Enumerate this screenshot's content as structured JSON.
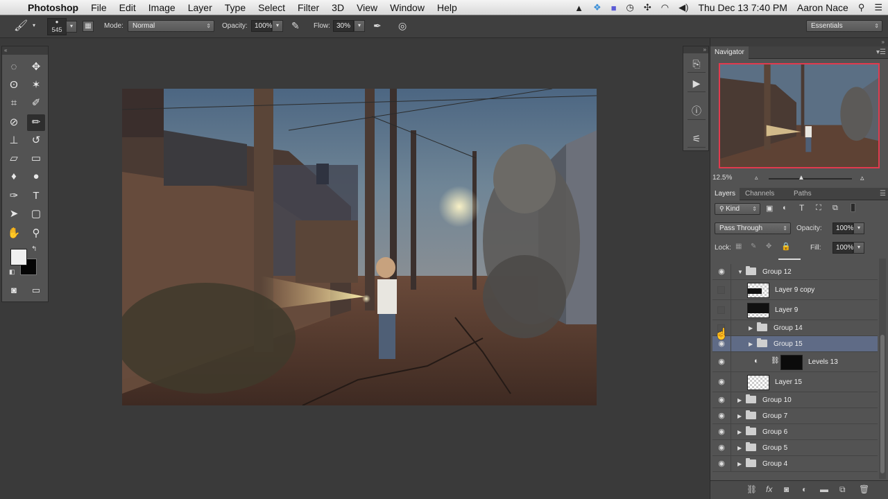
{
  "menubar": {
    "app_name": "Photoshop",
    "items": [
      "File",
      "Edit",
      "Image",
      "Layer",
      "Type",
      "Select",
      "Filter",
      "3D",
      "View",
      "Window",
      "Help"
    ],
    "clock": "Thu Dec 13  7:40 PM",
    "user": "Aaron Nace"
  },
  "options": {
    "brush_size": "545",
    "mode_label": "Mode:",
    "mode_value": "Normal",
    "opacity_label": "Opacity:",
    "opacity_value": "100%",
    "flow_label": "Flow:",
    "flow_value": "30%",
    "workspace": "Essentials"
  },
  "navigator": {
    "tab": "Navigator",
    "zoom": "12.5%"
  },
  "layers_panel": {
    "tabs": [
      "Layers",
      "Channels",
      "Paths"
    ],
    "filter_kind": "Kind",
    "blend_mode": "Pass Through",
    "opacity_label": "Opacity:",
    "opacity_value": "100%",
    "lock_label": "Lock:",
    "fill_label": "Fill:",
    "fill_value": "100%",
    "layers": [
      {
        "name": "Group 12"
      },
      {
        "name": "Layer 9 copy"
      },
      {
        "name": "Layer 9"
      },
      {
        "name": "Group 14"
      },
      {
        "name": "Group 15"
      },
      {
        "name": "Levels 13"
      },
      {
        "name": "Layer 15"
      },
      {
        "name": "Group 10"
      },
      {
        "name": "Group 7"
      },
      {
        "name": "Group 6"
      },
      {
        "name": "Group 5"
      },
      {
        "name": "Group 4"
      }
    ]
  }
}
